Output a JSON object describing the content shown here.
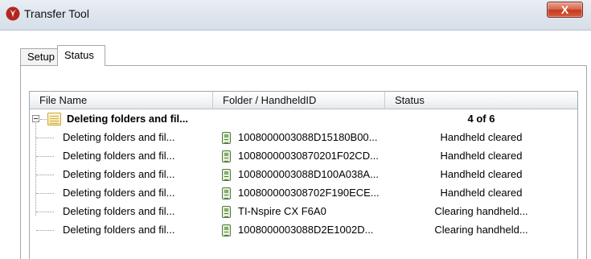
{
  "window": {
    "title": "Transfer Tool",
    "close_glyph": "X",
    "app_icon": "ti-logo-icon",
    "colors": {
      "titlebar": "#dfe6ee",
      "close": "#c3391d"
    }
  },
  "tabs": [
    {
      "label": "Setup",
      "selected": false
    },
    {
      "label": "Status",
      "selected": true
    }
  ],
  "table": {
    "columns": [
      "File Name",
      "Folder / HandheldID",
      "Status"
    ],
    "group": {
      "name": "Deleting folders and fil...",
      "folder": "",
      "status": "4 of 6",
      "expanded": true,
      "icon": "folder-icon"
    },
    "rows": [
      {
        "name": "Deleting folders and fil...",
        "folder": "1008000003088D15180B00...",
        "status": "Handheld cleared",
        "icon": "handheld-icon"
      },
      {
        "name": "Deleting folders and fil...",
        "folder": "10080000030870201F02CD...",
        "status": "Handheld cleared",
        "icon": "handheld-icon"
      },
      {
        "name": "Deleting folders and fil...",
        "folder": "1008000003088D100A038A...",
        "status": "Handheld cleared",
        "icon": "handheld-icon"
      },
      {
        "name": "Deleting folders and fil...",
        "folder": "100800000308702F190ECE...",
        "status": "Handheld cleared",
        "icon": "handheld-icon"
      },
      {
        "name": "Deleting folders and fil...",
        "folder": "TI-Nspire CX F6A0",
        "status": "Clearing handheld...",
        "icon": "handheld-icon"
      },
      {
        "name": "Deleting folders and fil...",
        "folder": "1008000003088D2E1002D...",
        "status": "Clearing handheld...",
        "icon": "handheld-icon"
      }
    ]
  }
}
